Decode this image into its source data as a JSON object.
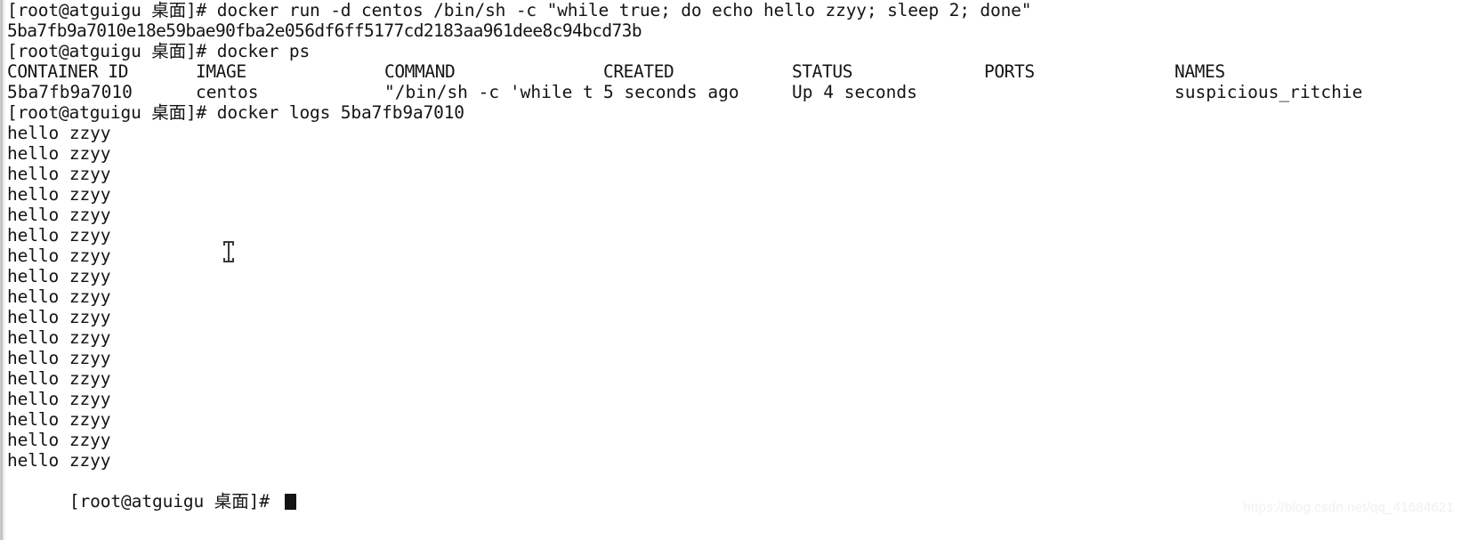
{
  "terminal": {
    "prompt": "[root@atguigu 桌面]# ",
    "lines": [
      {
        "type": "command",
        "text": "[root@atguigu 桌面]# docker run -d centos /bin/sh -c \"while true; do echo hello zzyy; sleep 2; done\""
      },
      {
        "type": "hash",
        "text": "5ba7fb9a7010e18e59bae90fba2e056df6ff5177cd2183aa961dee8c94bcd73b"
      },
      {
        "type": "command",
        "text": "[root@atguigu 桌面]# docker ps"
      }
    ],
    "logs_command": "[root@atguigu 桌面]# docker logs 5ba7fb9a7010",
    "log_output": [
      "hello zzyy",
      "hello zzyy",
      "hello zzyy",
      "hello zzyy",
      "hello zzyy",
      "hello zzyy",
      "hello zzyy",
      "hello zzyy",
      "hello zzyy",
      "hello zzyy",
      "hello zzyy",
      "hello zzyy",
      "hello zzyy",
      "hello zzyy",
      "hello zzyy",
      "hello zzyy",
      "hello zzyy"
    ],
    "final_prompt": "[root@atguigu 桌面]# ",
    "colors": {
      "background": "#ffffff",
      "foreground": "#141414",
      "cursor": "#141414",
      "watermark": "#f0f0f0"
    }
  },
  "docker_ps": {
    "headers": {
      "container_id": "CONTAINER ID",
      "image": "IMAGE",
      "command": "COMMAND",
      "created": "CREATED",
      "status": "STATUS",
      "ports": "PORTS",
      "names": "NAMES"
    },
    "row": {
      "container_id": "5ba7fb9a7010",
      "image": "centos",
      "command": "\"/bin/sh -c 'while t",
      "created": "5 seconds ago",
      "status": "Up 4 seconds",
      "ports": "",
      "names": "suspicious_ritchie"
    }
  },
  "watermark": {
    "text": "https://blog.csdn.net/qq_41684621"
  }
}
